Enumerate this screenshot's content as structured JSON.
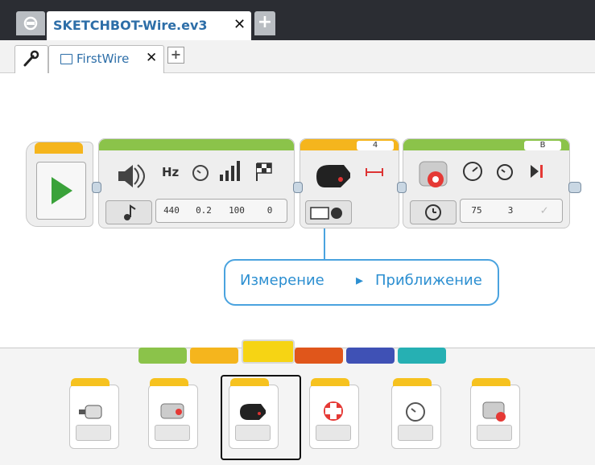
{
  "project_tab": {
    "label": "SKETCHBOT-Wire.ev3",
    "close": "✕",
    "add": "+"
  },
  "program_tab": {
    "label": "FirstWire",
    "close": "✕",
    "add": "+"
  },
  "blocks": {
    "sound": {
      "params": [
        "440",
        "0.2",
        "100",
        "0"
      ],
      "labels": [
        "Hz"
      ]
    },
    "ir_sensor": {
      "port": "4"
    },
    "motor": {
      "port": "B",
      "params": [
        "75",
        "3"
      ]
    }
  },
  "callout": {
    "mode": "Измерение",
    "arrow": "▸",
    "submode": "Приближение"
  },
  "palette": {
    "tab_colors": [
      "#8bc34a",
      "#f5b51d",
      "#f6d414",
      "#e0561b",
      "#3f51b5",
      "#26b0b3"
    ],
    "selected_index": 2
  }
}
